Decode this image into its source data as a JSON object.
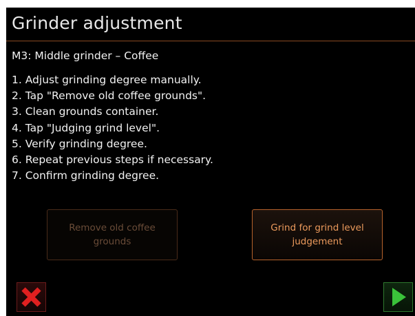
{
  "header": {
    "title": "Grinder adjustment"
  },
  "subtitle": "M3: Middle grinder – Coffee",
  "steps": [
    "1. Adjust grinding degree manually.",
    "2. Tap \"Remove old coffee grounds\".",
    "3. Clean grounds container.",
    "4. Tap \"Judging grind level\".",
    "5. Verify grinding degree.",
    "6. Repeat previous steps if necessary.",
    "7. Confirm grinding degree."
  ],
  "buttons": {
    "remove_label": "Remove old coffee grounds",
    "remove_enabled": false,
    "grind_label": "Grind for grind level judgement",
    "grind_enabled": true
  },
  "footer": {
    "cancel_icon": "close-icon",
    "next_icon": "play-icon"
  },
  "colors": {
    "background": "#000000",
    "accent_orange": "#e08a4a",
    "cancel_red": "#e02020",
    "next_green": "#3ac23a"
  }
}
